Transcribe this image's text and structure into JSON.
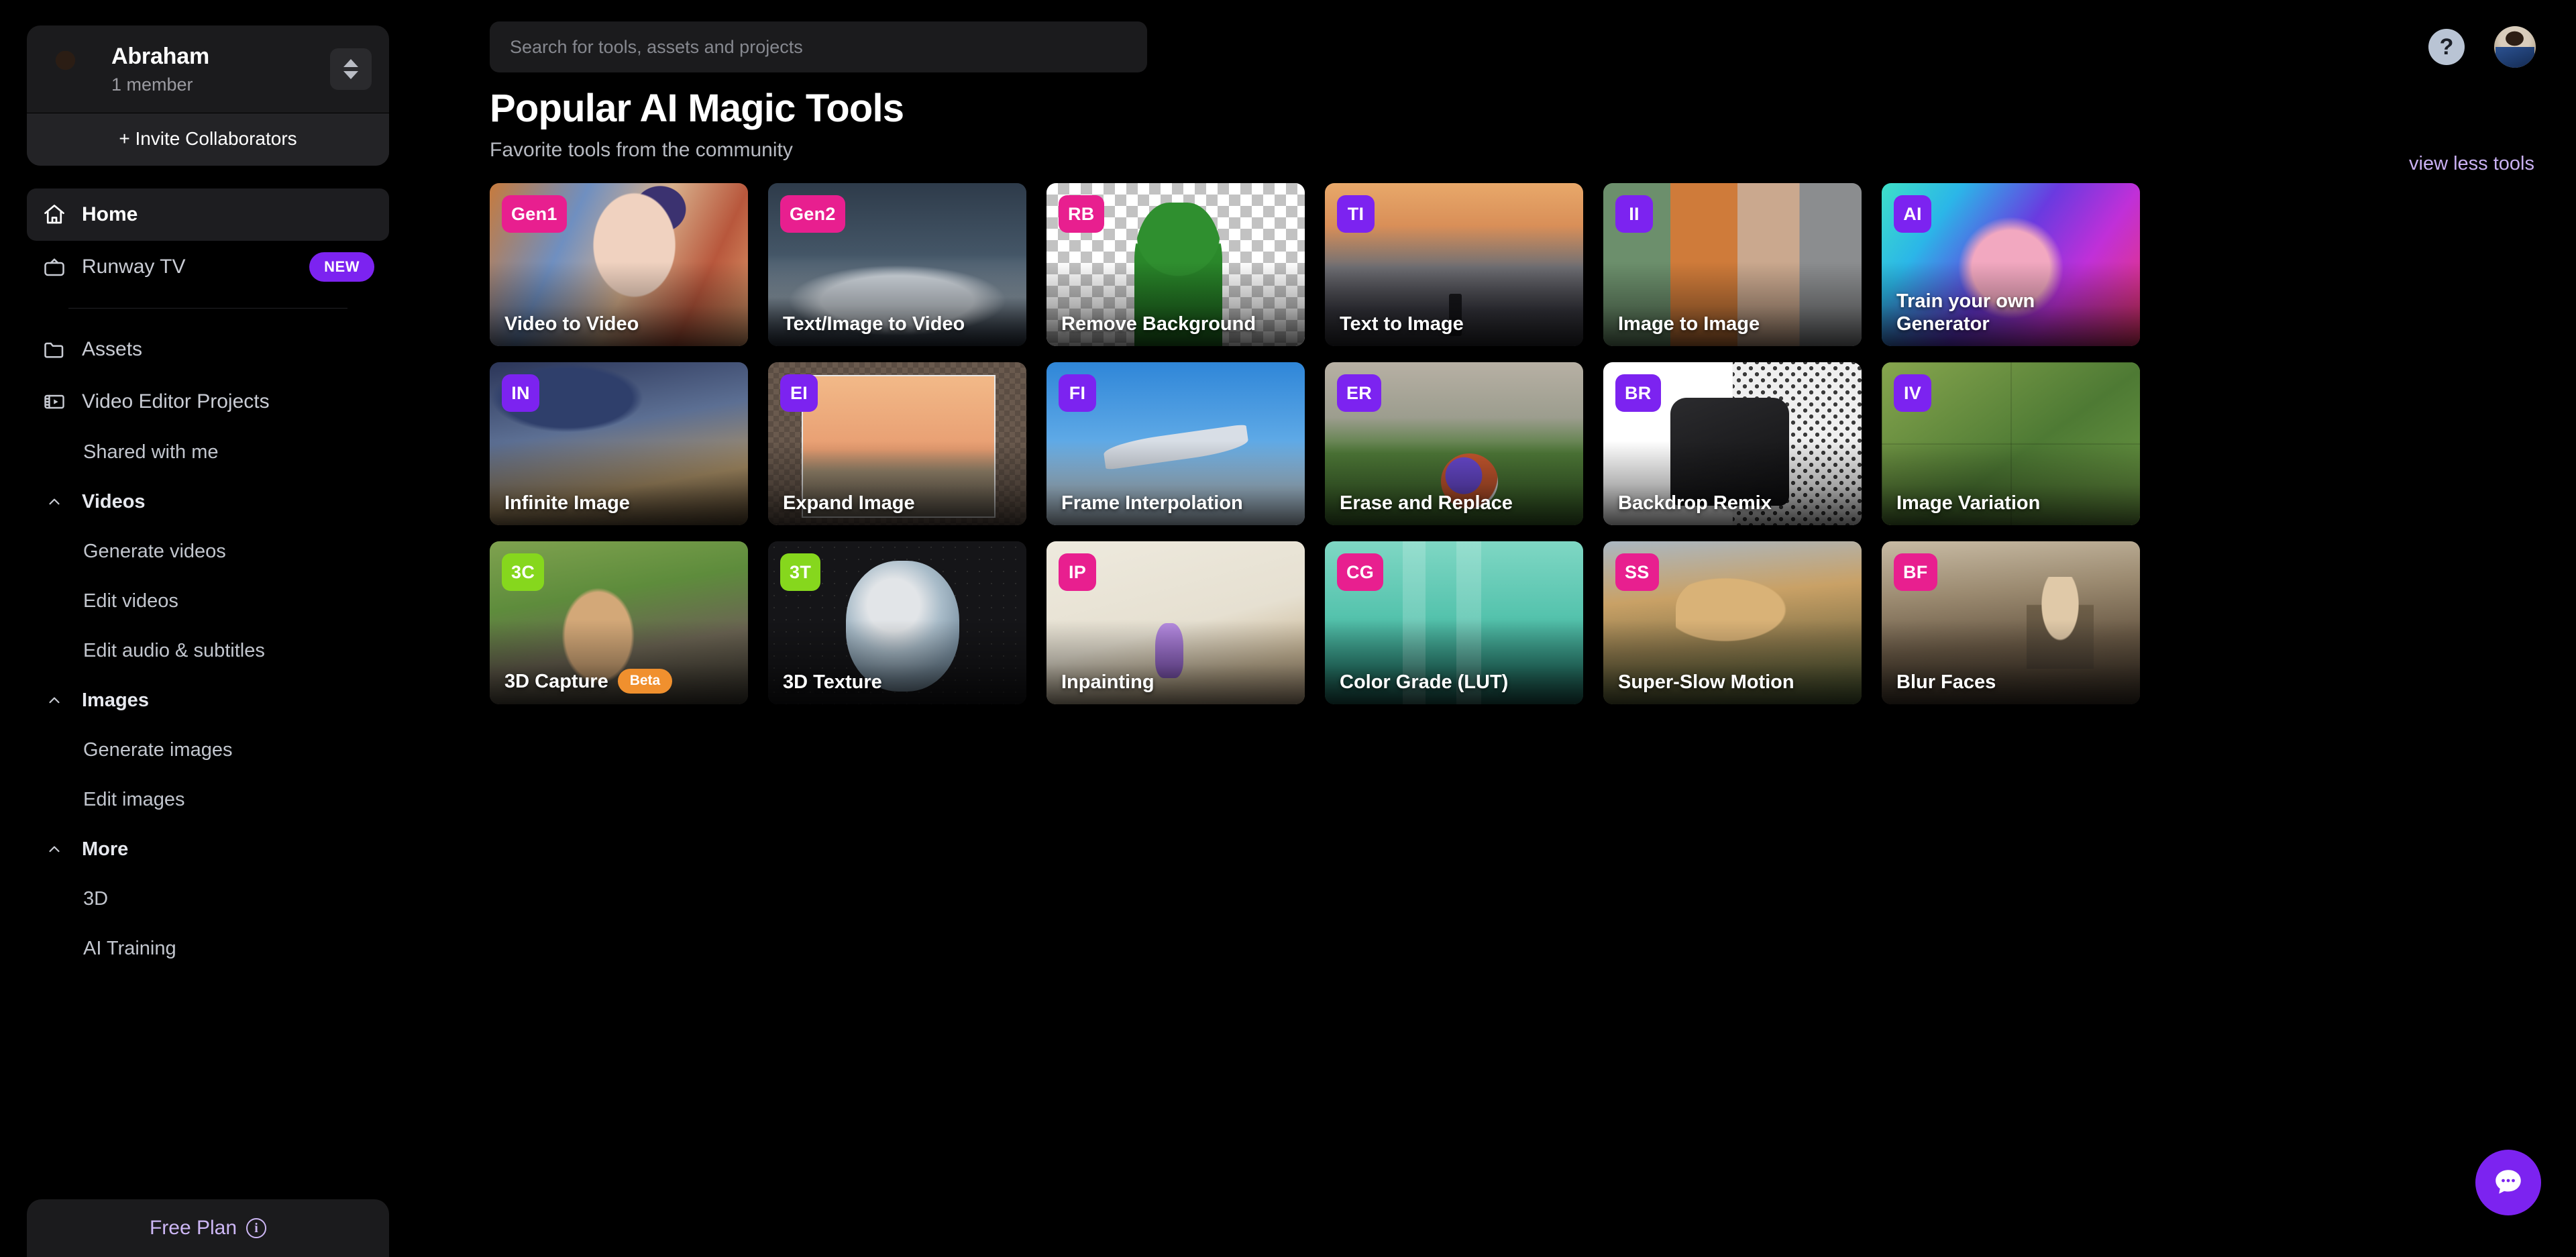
{
  "workspace": {
    "name": "Abraham",
    "members": "1 member",
    "invite_label": "+ Invite Collaborators",
    "switcher_icon": "up-down-chevrons-icon",
    "avatar_icon": "workspace-avatar"
  },
  "sidebar": {
    "primary": [
      {
        "label": "Home",
        "icon": "home-icon",
        "active": true
      },
      {
        "label": "Runway TV",
        "icon": "tv-icon",
        "badge": "NEW"
      }
    ],
    "secondary": [
      {
        "label": "Assets",
        "icon": "folder-icon"
      },
      {
        "label": "Video Editor Projects",
        "icon": "film-strip-icon"
      },
      {
        "label": "Shared with me",
        "icon": "none"
      }
    ],
    "groups": [
      {
        "label": "Videos",
        "icon": "chevron-up-icon",
        "items": [
          "Generate videos",
          "Edit videos",
          "Edit audio & subtitles"
        ]
      },
      {
        "label": "Images",
        "icon": "chevron-up-icon",
        "items": [
          "Generate images",
          "Edit images"
        ]
      },
      {
        "label": "More",
        "icon": "chevron-up-icon",
        "items": [
          "3D",
          "AI Training"
        ]
      }
    ],
    "plan": {
      "label": "Free Plan",
      "icon": "info-icon",
      "color": "#cdb7f5"
    }
  },
  "topbar": {
    "search_placeholder": "Search for tools, assets and projects",
    "search_value": "",
    "help_icon": "question-mark-icon",
    "avatar_icon": "user-avatar"
  },
  "header": {
    "title": "Popular AI Magic Tools",
    "subtitle": "Favorite tools from the community",
    "view_toggle": "view less tools"
  },
  "colors": {
    "badge_purple": "#7c23f0",
    "badge_pink": "#e81f8f",
    "badge_green": "#86d71d",
    "beta_orange": "#f0902e",
    "accent_lavender": "#cdb7f5",
    "background": "#000000",
    "panel": "#1b1b1d"
  },
  "tools": [
    {
      "badge": "Gen1",
      "badge_color": "pink",
      "title": "Video to Video",
      "art": "art-v2v"
    },
    {
      "badge": "Gen2",
      "badge_color": "pink",
      "title": "Text/Image to Video",
      "art": "art-t2v"
    },
    {
      "badge": "RB",
      "badge_color": "pink",
      "title": "Remove Background",
      "art": "art-rb"
    },
    {
      "badge": "TI",
      "badge_color": "purple",
      "title": "Text to Image",
      "art": "art-t2i"
    },
    {
      "badge": "II",
      "badge_color": "purple",
      "title": "Image to Image",
      "art": "art-i2i"
    },
    {
      "badge": "AI",
      "badge_color": "purple",
      "title": "Train your own Generator",
      "art": "art-train"
    },
    {
      "badge": "IN",
      "badge_color": "purple",
      "title": "Infinite Image",
      "art": "art-infinite"
    },
    {
      "badge": "EI",
      "badge_color": "purple",
      "title": "Expand Image",
      "art": "art-expand"
    },
    {
      "badge": "FI",
      "badge_color": "purple",
      "title": "Frame Interpolation",
      "art": "art-frame"
    },
    {
      "badge": "ER",
      "badge_color": "purple",
      "title": "Erase and Replace",
      "art": "art-erase"
    },
    {
      "badge": "BR",
      "badge_color": "purple",
      "title": "Backdrop Remix",
      "art": "art-backdrop"
    },
    {
      "badge": "IV",
      "badge_color": "purple",
      "title": "Image Variation",
      "art": "art-var"
    },
    {
      "badge": "3C",
      "badge_color": "green",
      "title": "3D Capture",
      "art": "art-3dc",
      "tag": "Beta"
    },
    {
      "badge": "3T",
      "badge_color": "green",
      "title": "3D Texture",
      "art": "art-3dt"
    },
    {
      "badge": "IP",
      "badge_color": "pink",
      "title": "Inpainting",
      "art": "art-inp"
    },
    {
      "badge": "CG",
      "badge_color": "pink",
      "title": "Color Grade (LUT)",
      "art": "art-cg"
    },
    {
      "badge": "SS",
      "badge_color": "pink",
      "title": "Super-Slow Motion",
      "art": "art-ss"
    },
    {
      "badge": "BF",
      "badge_color": "pink",
      "title": "Blur Faces",
      "art": "art-bf"
    }
  ],
  "fab": {
    "icon": "chat-bubble-icon"
  }
}
